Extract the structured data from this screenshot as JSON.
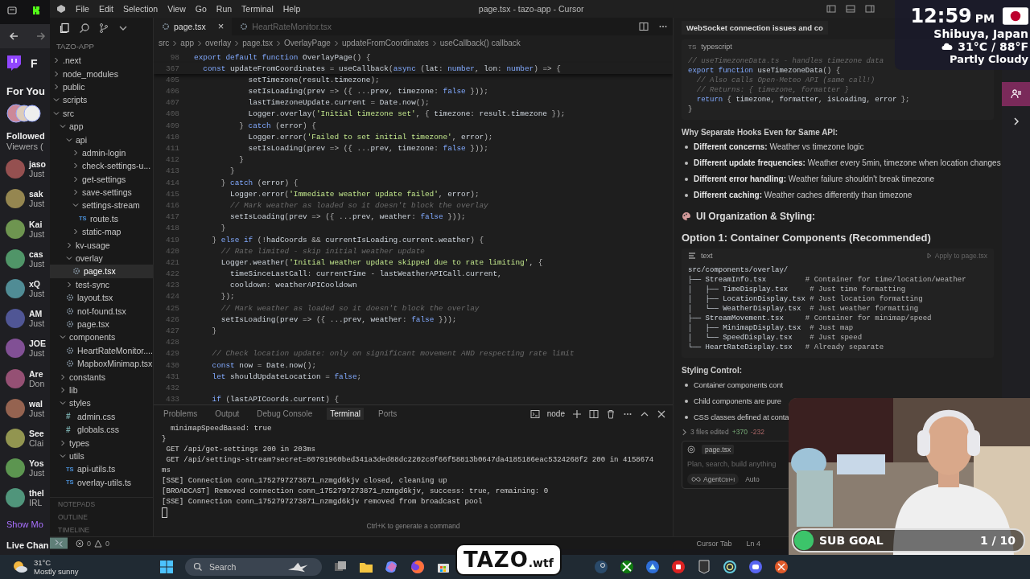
{
  "browser": {
    "sidebar_heading": "For You",
    "sidebar_cut": "F",
    "followed": "Followed",
    "viewers": "Viewers (",
    "channels": [
      {
        "name": "jaso",
        "status": "Just"
      },
      {
        "name": "sak",
        "status": "Just"
      },
      {
        "name": "Kai",
        "status": "Just"
      },
      {
        "name": "cas",
        "status": "Just"
      },
      {
        "name": "xQ",
        "status": "Just"
      },
      {
        "name": "AM",
        "status": "Just"
      },
      {
        "name": "JOE",
        "status": "Just"
      },
      {
        "name": "Are",
        "status": "Don"
      },
      {
        "name": "wal",
        "status": "Just"
      },
      {
        "name": "See",
        "status": "Clai"
      },
      {
        "name": "Yos",
        "status": "Just"
      },
      {
        "name": "thel",
        "status": "IRL"
      }
    ],
    "show_more": "Show Mo",
    "live_channels": "Live Chan"
  },
  "window": {
    "title": "page.tsx - tazo-app - Cursor",
    "menu": [
      "File",
      "Edit",
      "Selection",
      "View",
      "Go",
      "Run",
      "Terminal",
      "Help"
    ]
  },
  "explorer": {
    "title": "TAZO-APP",
    "tree": [
      {
        "label": ".next",
        "kind": "folder",
        "expanded": false,
        "selected": false
      },
      {
        "label": "node_modules",
        "kind": "folder",
        "expanded": false,
        "selected": false
      },
      {
        "label": "public",
        "kind": "folder",
        "expanded": false,
        "selected": false
      },
      {
        "label": "scripts",
        "kind": "folder",
        "expanded": true,
        "selected": false
      },
      {
        "label": "src",
        "kind": "folder",
        "expanded": true,
        "selected": false,
        "children": [
          {
            "label": "app",
            "kind": "folder",
            "expanded": true,
            "selected": false,
            "children": [
              {
                "label": "api",
                "kind": "folder",
                "expanded": true,
                "selected": false,
                "children": [
                  {
                    "label": "admin-login",
                    "kind": "folder",
                    "expanded": false,
                    "selected": false
                  },
                  {
                    "label": "check-settings-u...",
                    "kind": "folder",
                    "expanded": false,
                    "selected": false
                  },
                  {
                    "label": "get-settings",
                    "kind": "folder",
                    "expanded": false,
                    "selected": false
                  },
                  {
                    "label": "save-settings",
                    "kind": "folder",
                    "expanded": false,
                    "selected": false
                  },
                  {
                    "label": "settings-stream",
                    "kind": "folder",
                    "expanded": true,
                    "selected": false,
                    "children": [
                      {
                        "label": "route.ts",
                        "kind": "ts",
                        "badge": "TS",
                        "selected": false
                      }
                    ]
                  },
                  {
                    "label": "static-map",
                    "kind": "folder",
                    "expanded": false,
                    "selected": false
                  }
                ]
              },
              {
                "label": "kv-usage",
                "kind": "folder",
                "expanded": false,
                "selected": false
              },
              {
                "label": "overlay",
                "kind": "folder",
                "expanded": true,
                "selected": false,
                "children": [
                  {
                    "label": "page.tsx",
                    "kind": "tsx",
                    "selected": true
                  }
                ]
              },
              {
                "label": "test-sync",
                "kind": "folder",
                "expanded": false,
                "selected": false
              },
              {
                "label": "layout.tsx",
                "kind": "tsx",
                "selected": false
              },
              {
                "label": "not-found.tsx",
                "kind": "tsx",
                "selected": false
              },
              {
                "label": "page.tsx",
                "kind": "tsx",
                "selected": false
              }
            ]
          },
          {
            "label": "components",
            "kind": "folder",
            "expanded": true,
            "selected": false,
            "children": [
              {
                "label": "HeartRateMonitor....",
                "kind": "tsx",
                "selected": false
              },
              {
                "label": "MapboxMinimap.tsx",
                "kind": "tsx",
                "selected": false
              }
            ]
          },
          {
            "label": "constants",
            "kind": "folder",
            "expanded": false,
            "selected": false
          },
          {
            "label": "lib",
            "kind": "folder",
            "expanded": false,
            "selected": false
          },
          {
            "label": "styles",
            "kind": "folder",
            "expanded": true,
            "selected": false,
            "children": [
              {
                "label": "admin.css",
                "kind": "css",
                "badge": "#",
                "selected": false
              },
              {
                "label": "globals.css",
                "kind": "css",
                "badge": "#",
                "selected": false
              }
            ]
          },
          {
            "label": "types",
            "kind": "folder",
            "expanded": false,
            "selected": false
          },
          {
            "label": "utils",
            "kind": "folder",
            "expanded": true,
            "selected": false,
            "children": [
              {
                "label": "api-utils.ts",
                "kind": "ts",
                "badge": "TS",
                "selected": false
              },
              {
                "label": "overlay-utils.ts",
                "kind": "ts",
                "badge": "TS",
                "selected": false
              }
            ]
          }
        ]
      }
    ],
    "sections": [
      "NOTEPADS",
      "OUTLINE",
      "TIMELINE"
    ]
  },
  "editor": {
    "tabs": [
      {
        "label": "page.tsx",
        "selected": true,
        "close": "×"
      },
      {
        "label": "HeartRateMonitor.tsx",
        "selected": false
      }
    ],
    "breadcrumb": [
      "src",
      "app",
      "overlay",
      "page.tsx",
      "OverlayPage",
      "updateFromCoordinates",
      "useCallback() callback"
    ],
    "lines": [
      {
        "n": "98",
        "t": "export default function OverlayPage() {"
      },
      {
        "n": "367",
        "t": "  const updateFromCoordinates = useCallback(async (lat: number, lon: number) => {"
      },
      {
        "n": "405",
        "t": "            setTimezone(result.timezone);"
      },
      {
        "n": "406",
        "t": "            setIsLoading(prev => ({ ...prev, timezone: false }));"
      },
      {
        "n": "407",
        "t": "            lastTimezoneUpdate.current = Date.now();"
      },
      {
        "n": "408",
        "t": "            Logger.overlay('Initial timezone set', { timezone: result.timezone });"
      },
      {
        "n": "409",
        "t": "          } catch (error) {"
      },
      {
        "n": "410",
        "t": "            Logger.error('Failed to set initial timezone', error);"
      },
      {
        "n": "411",
        "t": "            setIsLoading(prev => ({ ...prev, timezone: false }));"
      },
      {
        "n": "412",
        "t": "          }"
      },
      {
        "n": "413",
        "t": "        }"
      },
      {
        "n": "414",
        "t": "      } catch (error) {"
      },
      {
        "n": "415",
        "t": "        Logger.error('Immediate weather update failed', error);"
      },
      {
        "n": "416",
        "t": "        // Mark weather as loaded so it doesn't block the overlay"
      },
      {
        "n": "417",
        "t": "        setIsLoading(prev => ({ ...prev, weather: false }));"
      },
      {
        "n": "418",
        "t": "      }"
      },
      {
        "n": "419",
        "t": "    } else if (!hadCoords && currentIsLoading.current.weather) {"
      },
      {
        "n": "420",
        "t": "      // Rate limited - skip initial weather update"
      },
      {
        "n": "421",
        "t": "      Logger.weather('Initial weather update skipped due to rate limiting', {"
      },
      {
        "n": "422",
        "t": "        timeSinceLastCall: currentTime - lastWeatherAPICall.current,"
      },
      {
        "n": "423",
        "t": "        cooldown: weatherAPICooldown"
      },
      {
        "n": "424",
        "t": "      });"
      },
      {
        "n": "425",
        "t": "      // Mark weather as loaded so it doesn't block the overlay"
      },
      {
        "n": "426",
        "t": "      setIsLoading(prev => ({ ...prev, weather: false }));"
      },
      {
        "n": "427",
        "t": "    }"
      },
      {
        "n": "428"
      },
      {
        "n": "429",
        "t": "    // Check location update: only on significant movement AND respecting rate limit"
      },
      {
        "n": "430",
        "t": "    const now = Date.now();"
      },
      {
        "n": "431",
        "t": "    let shouldUpdateLocation = false;"
      },
      {
        "n": "432"
      },
      {
        "n": "433",
        "t": "    if (lastAPICoords.current) {"
      }
    ]
  },
  "panel": {
    "tabs": [
      {
        "label": "Problems",
        "selected": false
      },
      {
        "label": "Output",
        "selected": false
      },
      {
        "label": "Debug Console",
        "selected": false
      },
      {
        "label": "Terminal",
        "selected": true
      },
      {
        "label": "Ports",
        "selected": false
      }
    ],
    "shell": "node",
    "lines": [
      "  minimapSpeedBased: true",
      "}",
      " GET /api/get-settings 200 in 203ms",
      " GET /api/settings-stream?secret=80791960bed341a3ded88dc2202c8f66f58813b0647da4185186eac5324268f2 200 in 4158674",
      "ms",
      "[SSE] Connection conn_1752797273871_nzmgd6kjv closed, cleaning up",
      "[BROADCAST] Removed connection conn_1752797273871_nzmgd6kjv, success: true, remaining: 0",
      "[SSE] Connection conn_1752797273871_nzmgd6kjv removed from broadcast pool"
    ],
    "hint": "Ctrl+K to generate a command"
  },
  "chat": {
    "title": "WebSocket connection issues and co",
    "code1": {
      "badge": "TS",
      "lang": "typescript",
      "lines": [
        "// useTimezoneData.ts - handles timezone data",
        "export function useTimezoneData() {",
        "  // Also calls Open-Meteo API (same call!)",
        "  // Returns: { timezone, formatter }",
        "  return { timezone, formatter, isLoading, error };",
        "}"
      ]
    },
    "heading1": "Why Separate Hooks Even for Same API:",
    "bullets1": [
      "**Different concerns:** Weather vs timezone logic",
      "**Different update frequencies:** Weather every 5min, timezone when location changes",
      "**Different error handling:** Weather failure shouldn't break timezone",
      "**Different caching:** Weather caches differently than timezone"
    ],
    "heading2": "UI Organization & Styling:",
    "heading3": "Option 1: Container Components (Recommended)",
    "code2": {
      "lang": "text",
      "apply": "Apply to page.tsx",
      "lines": [
        "src/components/overlay/",
        "├── StreamInfo.tsx         # Container for time/location/weather",
        "│   ├── TimeDisplay.tsx     # Just time formatting",
        "│   ├── LocationDisplay.tsx # Just location formatting",
        "│   └── WeatherDisplay.tsx  # Just weather formatting",
        "├── StreamMovement.tsx     # Container for minimap/speed",
        "│   ├── MinimapDisplay.tsx  # Just map",
        "│   └── SpeedDisplay.tsx    # Just speed",
        "└── HeartRateDisplay.tsx   # Already separate"
      ]
    },
    "heading4": "Styling Control:",
    "bullets2": [
      "Container components cont",
      "Child components are pure",
      "CSS classes defined at conta"
    ],
    "edited": "3 files edited",
    "added": "+370",
    "removed": "-232",
    "chip": "page.tsx",
    "placeholder": "Plan, search, build anything",
    "mode": "Agent",
    "shortcut": "Ctrl+I",
    "model": "Auto"
  },
  "status": {
    "errors": "0",
    "warnings": "0",
    "right": [
      "Cursor Tab",
      "Ln 4"
    ]
  },
  "overlay": {
    "time": "12:59",
    "ampm": "PM",
    "city": "Shibuya, Japan",
    "temp": "31°C / 88°F",
    "condition": "Partly Cloudy",
    "goal_label": "SUB GOAL",
    "goal_count": "1 / 10",
    "logo": "TAZO",
    "logo_suffix": ".wtf"
  },
  "taskbar": {
    "temp": "31°C",
    "condition": "Mostly sunny",
    "search": "Search"
  }
}
